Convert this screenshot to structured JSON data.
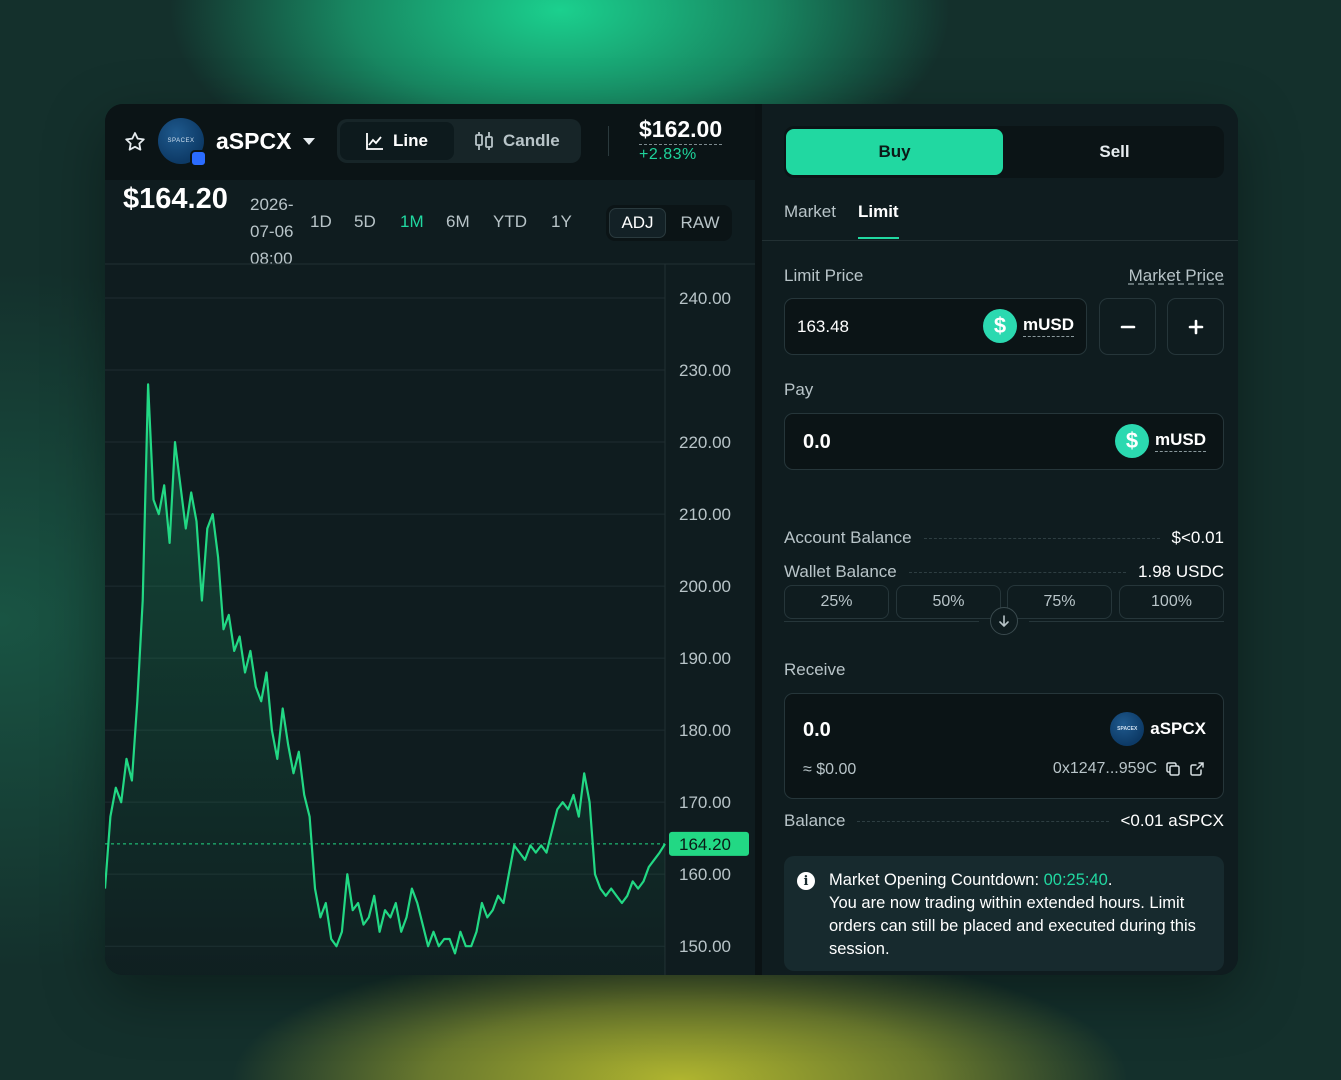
{
  "header": {
    "ticker": "aSPCX",
    "logo_text": "SPACEX",
    "view_tabs": [
      {
        "label": "Line",
        "active": true,
        "icon": "line-chart-icon"
      },
      {
        "label": "Candle",
        "active": false,
        "icon": "candlestick-icon"
      }
    ],
    "price": "$162.00",
    "change": "+2.83%"
  },
  "chart_header": {
    "price": "$164.20",
    "timestamp": "2026-07-06 08:00",
    "ranges": [
      {
        "label": "1D",
        "active": false
      },
      {
        "label": "5D",
        "active": false
      },
      {
        "label": "1M",
        "active": true
      },
      {
        "label": "6M",
        "active": false
      },
      {
        "label": "YTD",
        "active": false
      },
      {
        "label": "1Y",
        "active": false
      }
    ],
    "adj_label": "ADJ",
    "raw_label": "RAW"
  },
  "chart_data": {
    "type": "area",
    "y_ticks": [
      "240.00",
      "230.00",
      "220.00",
      "210.00",
      "200.00",
      "190.00",
      "180.00",
      "170.00",
      "160.00",
      "150.00"
    ],
    "ylim": [
      146,
      245
    ],
    "current_value": 164.2,
    "current_label": "164.20",
    "line_color": "#22d884",
    "values": [
      158,
      168,
      172,
      170,
      176,
      173,
      184,
      198,
      228,
      212,
      210,
      214,
      206,
      220,
      214,
      208,
      213,
      209,
      198,
      208,
      210,
      204,
      194,
      196,
      191,
      193,
      188,
      191,
      186,
      184,
      188,
      180,
      176,
      183,
      178,
      174,
      177,
      171,
      168,
      158,
      154,
      156,
      151,
      150,
      152,
      160,
      155,
      156,
      153,
      154,
      157,
      152,
      155,
      154,
      156,
      152,
      154,
      158,
      156,
      153,
      150,
      152,
      150,
      151,
      151,
      149,
      152,
      150,
      150,
      152,
      156,
      154,
      155,
      157,
      156,
      160,
      164,
      163,
      162,
      164,
      163,
      164,
      163,
      166,
      169,
      170,
      169,
      171,
      168,
      174,
      170,
      160,
      158,
      157,
      158,
      157,
      156,
      157,
      159,
      158,
      159,
      161,
      162,
      163,
      164.2
    ]
  },
  "order": {
    "buy_label": "Buy",
    "sell_label": "Sell",
    "type_tabs": [
      {
        "label": "Market",
        "active": false
      },
      {
        "label": "Limit",
        "active": true
      }
    ],
    "limit_price_label": "Limit Price",
    "market_price_link": "Market Price",
    "limit_price_value": "163.48",
    "quote_token": "mUSD",
    "pay_label": "Pay",
    "pay_value": "0.0",
    "percentages": [
      "25%",
      "50%",
      "75%",
      "100%"
    ],
    "account_balance_label": "Account Balance",
    "account_balance_value": "$<0.01",
    "wallet_balance_label": "Wallet Balance",
    "wallet_balance_value": "1.98 USDC",
    "receive_label": "Receive",
    "receive_value": "0.0",
    "receive_token": "aSPCX",
    "receive_usd": "≈ $0.00",
    "receive_address": "0x1247...959C",
    "balance_label": "Balance",
    "balance_value": "<0.01 aSPCX",
    "notice_prefix": "Market Opening Countdown: ",
    "notice_countdown": "00:25:40",
    "notice_suffix": ".",
    "notice_body": "You are now trading within extended hours. Limit orders can still be placed and executed during this session."
  },
  "colors": {
    "accent": "#21d8a1",
    "chart_line": "#22d884",
    "card_bg": "#0f1c1f"
  }
}
